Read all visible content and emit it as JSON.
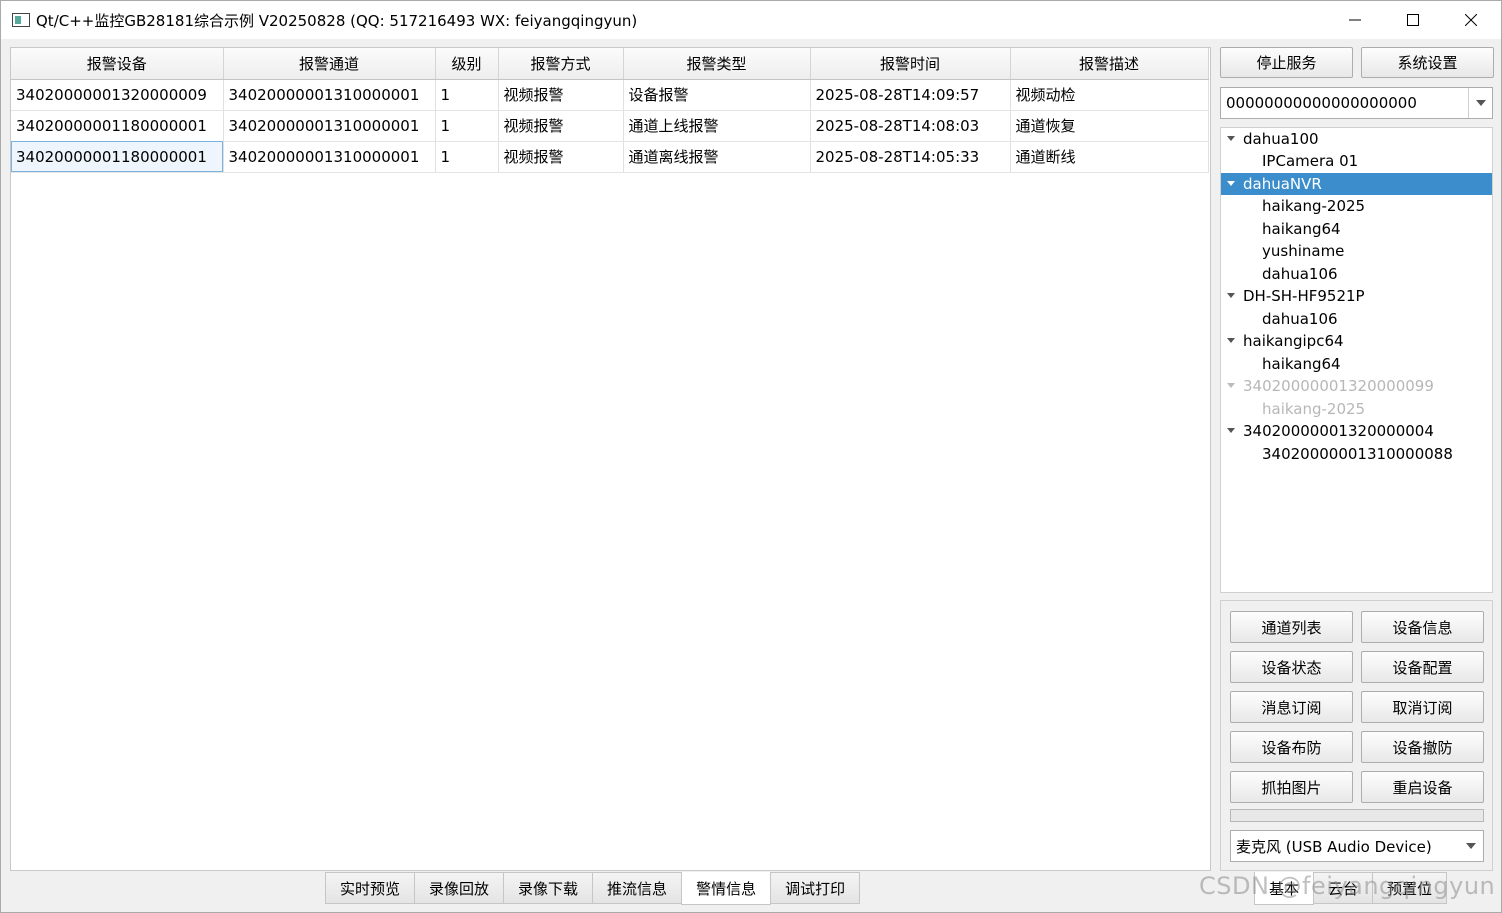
{
  "window": {
    "title": "Qt/C++监控GB28181综合示例 V20250828 (QQ: 517216493 WX: feiyangqingyun)"
  },
  "table": {
    "columns": [
      "报警设备",
      "报警通道",
      "级别",
      "报警方式",
      "报警类型",
      "报警时间",
      "报警描述"
    ],
    "rows": [
      [
        "34020000001320000009",
        "34020000001310000001",
        "1",
        "视频报警",
        "设备报警",
        "2025-08-28T14:09:57",
        "视频动检"
      ],
      [
        "34020000001180000001",
        "34020000001310000001",
        "1",
        "视频报警",
        "通道上线报警",
        "2025-08-28T14:08:03",
        "通道恢复"
      ],
      [
        "34020000001180000001",
        "34020000001310000001",
        "1",
        "视频报警",
        "通道离线报警",
        "2025-08-28T14:05:33",
        "通道断线"
      ]
    ]
  },
  "bottom_tabs": [
    "实时预览",
    "录像回放",
    "录像下载",
    "推流信息",
    "警情信息",
    "调试打印"
  ],
  "active_tab": "警情信息",
  "right_panel": {
    "stop_service": "停止服务",
    "system_settings": "系统设置",
    "device_combo_value": "00000000000000000000",
    "tree": [
      {
        "label": "dahua100",
        "level": 0
      },
      {
        "label": "IPCamera 01",
        "level": 1
      },
      {
        "label": "dahuaNVR",
        "level": 0,
        "selected": true
      },
      {
        "label": "haikang-2025",
        "level": 1
      },
      {
        "label": "haikang64",
        "level": 1
      },
      {
        "label": "yushiname",
        "level": 1
      },
      {
        "label": "dahua106",
        "level": 1
      },
      {
        "label": "DH-SH-HF9521P",
        "level": 0
      },
      {
        "label": "dahua106",
        "level": 1
      },
      {
        "label": "haikangipc64",
        "level": 0
      },
      {
        "label": "haikang64",
        "level": 1
      },
      {
        "label": "34020000001320000099",
        "level": 0,
        "disabled": true
      },
      {
        "label": "haikang-2025",
        "level": 1,
        "disabled": true
      },
      {
        "label": "34020000001320000004",
        "level": 0
      },
      {
        "label": "34020000001310000088",
        "level": 1
      }
    ],
    "buttons": [
      "通道列表",
      "设备信息",
      "设备状态",
      "设备配置",
      "消息订阅",
      "取消订阅",
      "设备布防",
      "设备撤防",
      "抓拍图片",
      "重启设备"
    ],
    "progress_value": 0,
    "audio_combo_value": "麦克风 (USB Audio Device)",
    "right_tabs": [
      "基本",
      "云台",
      "预置位"
    ]
  },
  "watermark": "CSDN @feiyangqingyun"
}
